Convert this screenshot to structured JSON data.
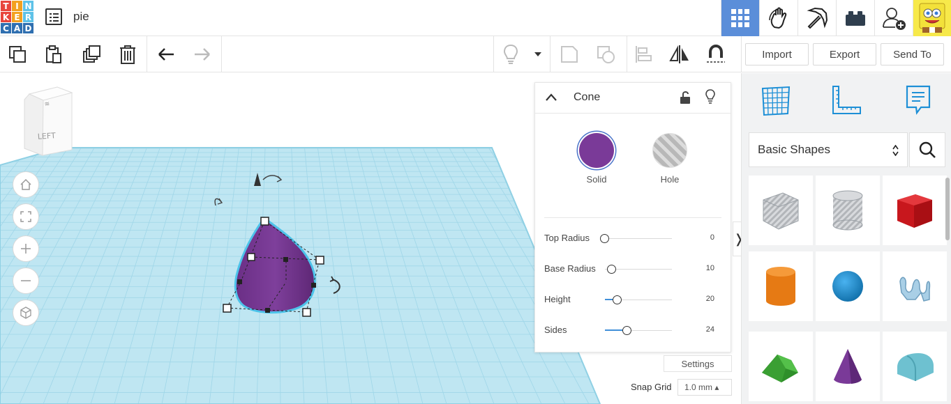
{
  "app": {
    "logo_letters": [
      "T",
      "I",
      "N",
      "K",
      "E",
      "R",
      "C",
      "A",
      "D"
    ],
    "logo_colors": [
      "#e8453c",
      "#f3a01f",
      "#5ec2e8",
      "#e8453c",
      "#f3a01f",
      "#5ec2e8",
      "#2f6fb0",
      "#2f6fb0",
      "#2f6fb0"
    ],
    "project_name": "pie"
  },
  "topnav": {
    "items": [
      "grid-view-icon",
      "hand-interact-icon",
      "pickaxe-icon",
      "bricks-icon",
      "add-user-icon"
    ],
    "active": "grid-view-icon",
    "active_color": "#5b8ed9"
  },
  "toolbar": {
    "import_label": "Import",
    "export_label": "Export",
    "send_to_label": "Send To"
  },
  "viewcube": {
    "face_label": "LEFT"
  },
  "inspector": {
    "title": "Cone",
    "solid_label": "Solid",
    "hole_label": "Hole",
    "solid_color": "#7a3a98",
    "props": [
      {
        "label": "Top Radius",
        "value": "0"
      },
      {
        "label": "Base Radius",
        "value": "10"
      },
      {
        "label": "Height",
        "value": "20"
      },
      {
        "label": "Sides",
        "value": "24"
      }
    ]
  },
  "workspace": {
    "settings_label": "Settings",
    "snap_label": "Snap Grid",
    "snap_value": "1.0 mm ▴"
  },
  "library": {
    "category": "Basic Shapes",
    "shapes": [
      "box-hole",
      "cylinder-hole",
      "box",
      "cylinder",
      "sphere",
      "scribble",
      "roof",
      "cone",
      "round-roof"
    ],
    "colors": {
      "box": "#d9262b",
      "cylinder": "#ef8a1f",
      "sphere": "#1e8ad2",
      "roof": "#3ba33a",
      "cone": "#7a3a98",
      "round_roof": "#6ec1d0",
      "grid": "#a6dceb"
    }
  }
}
